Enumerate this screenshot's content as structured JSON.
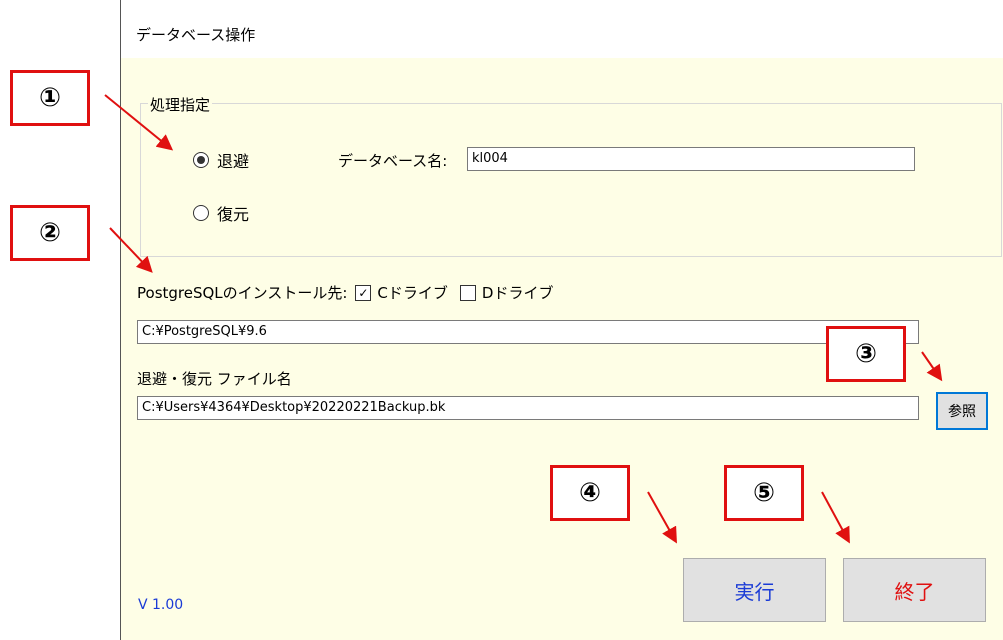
{
  "window": {
    "title": "データベース操作"
  },
  "processing": {
    "group_label": "処理指定",
    "options": [
      {
        "label": "退避",
        "selected": true
      },
      {
        "label": "復元",
        "selected": false
      }
    ],
    "db_name_label": "データベース名:",
    "db_name_value": "kl004"
  },
  "install": {
    "label": "PostgreSQLのインストール先:",
    "options": [
      {
        "label": "Cドライブ",
        "checked": true
      },
      {
        "label": "Dドライブ",
        "checked": false
      }
    ],
    "path_value": "C:¥PostgreSQL¥9.6"
  },
  "file": {
    "label": "退避・復元 ファイル名",
    "path_value": "C:¥Users¥4364¥Desktop¥20220221Backup.bk",
    "browse_label": "参照"
  },
  "buttons": {
    "execute_label": "実行",
    "exit_label": "終了"
  },
  "version": "V 1.00",
  "callouts": [
    "①",
    "②",
    "③",
    "④",
    "⑤"
  ],
  "colors": {
    "callout_border": "#e01010",
    "exit_text": "#e01010",
    "execute_text": "#1a3bd6",
    "version_text": "#1a3bd6",
    "window_bg": "#fefee6"
  }
}
